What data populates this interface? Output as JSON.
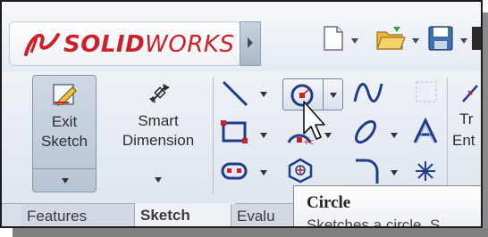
{
  "app": {
    "brand_bold": "SOLID",
    "brand_light": "WORKS",
    "brand_color": "#d11f2a"
  },
  "quick_access": {
    "icons": [
      "new-document-icon",
      "open-folder-icon",
      "save-icon"
    ]
  },
  "ribbon": {
    "exit_sketch": {
      "line1": "Exit",
      "line2": "Sketch",
      "icon": "exit-sketch-icon"
    },
    "smart_dimension": {
      "line1": "Smart",
      "line2": "Dimension",
      "icon": "smart-dimension-icon"
    },
    "tools": [
      {
        "name": "line",
        "icon": "line-icon"
      },
      {
        "name": "circle",
        "icon": "circle-icon"
      },
      {
        "name": "spline",
        "icon": "spline-icon"
      },
      {
        "name": "rectangle",
        "icon": "rectangle-icon"
      },
      {
        "name": "arc",
        "icon": "centerpoint-arc-icon"
      },
      {
        "name": "ellipse",
        "icon": "ellipse-icon"
      },
      {
        "name": "text",
        "icon": "text-icon"
      },
      {
        "name": "slot",
        "icon": "slot-icon"
      },
      {
        "name": "polygon",
        "icon": "polygon-icon"
      },
      {
        "name": "fillet",
        "icon": "sketch-fillet-icon"
      },
      {
        "name": "point",
        "icon": "point-icon"
      }
    ],
    "cut_off_label_1": "Tr",
    "cut_off_label_2": "Ent"
  },
  "tabs": [
    {
      "label": "Features",
      "active": false
    },
    {
      "label": "Sketch",
      "active": true
    },
    {
      "label": "Evalu",
      "active": false
    }
  ],
  "tooltip": {
    "title": "Circle",
    "body": "Sketches a circle. S"
  },
  "colors": {
    "accent_red": "#d11f2a",
    "icon_blue": "#1f3c88",
    "ribbon_bg": "#dfe6ee"
  }
}
